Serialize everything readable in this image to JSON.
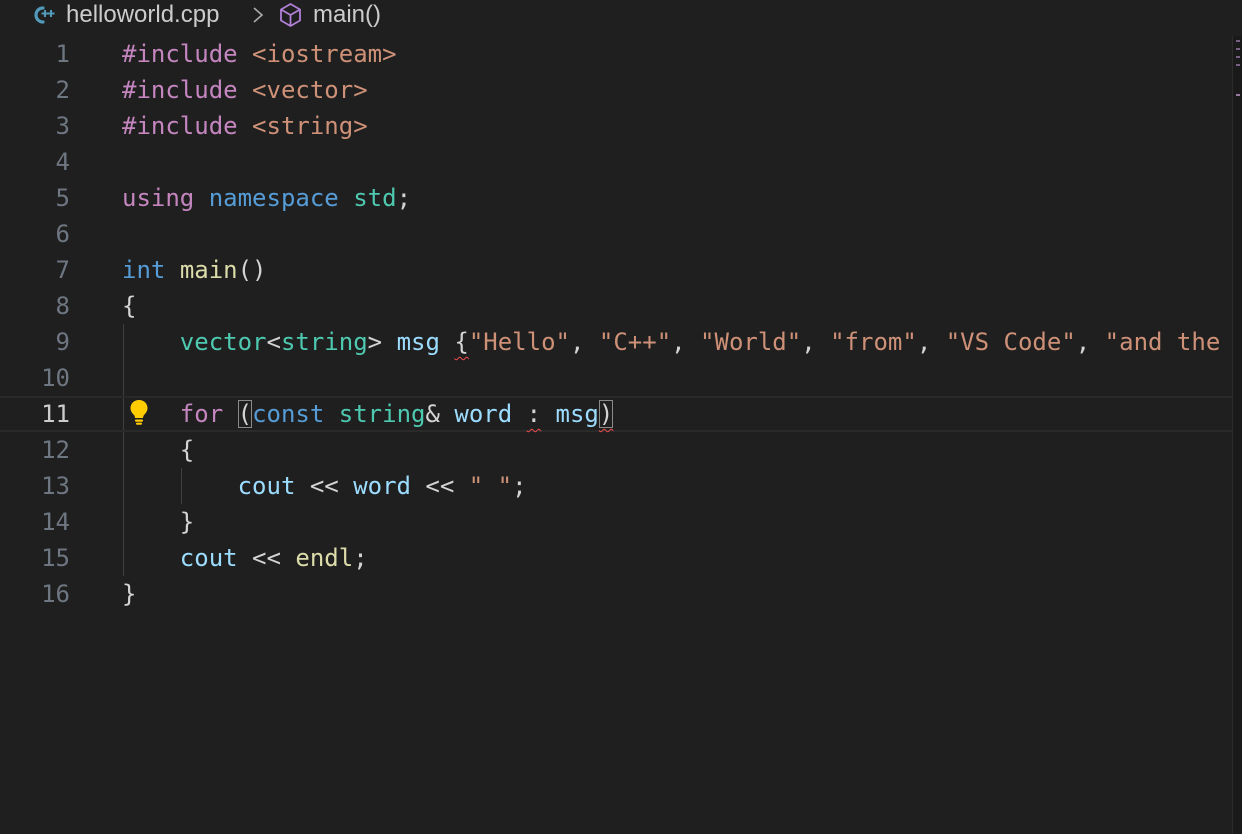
{
  "breadcrumb": {
    "file": "helloworld.cpp",
    "symbol": "main()",
    "file_icon": "cpp-file-icon",
    "separator_icon": "chevron-right-icon",
    "symbol_icon": "cube-method-icon"
  },
  "editor": {
    "current_line": 11,
    "line_numbers": [
      "1",
      "2",
      "3",
      "4",
      "5",
      "6",
      "7",
      "8",
      "9",
      "10",
      "11",
      "12",
      "13",
      "14",
      "15",
      "16"
    ],
    "code": {
      "l1": {
        "kw": "#include",
        "sp": " ",
        "hdr": "<iostream>"
      },
      "l2": {
        "kw": "#include",
        "sp": " ",
        "hdr": "<vector>"
      },
      "l3": {
        "kw": "#include",
        "sp": " ",
        "hdr": "<string>"
      },
      "l5": {
        "using": "using",
        "sp1": " ",
        "ns": "namespace",
        "sp2": " ",
        "std": "std",
        "semi": ";"
      },
      "l7": {
        "int": "int",
        "sp": " ",
        "main": "main",
        "parens": "()"
      },
      "l8": {
        "brace": "{"
      },
      "l9": {
        "indent": "    ",
        "vector": "vector",
        "lt": "<",
        "string": "string",
        "gt": ">",
        "sp1": " ",
        "msg": "msg",
        "sp2": " ",
        "brace": "{",
        "s1": "\"Hello\"",
        "c1": ", ",
        "s2": "\"C++\"",
        "c2": ", ",
        "s3": "\"World\"",
        "c3": ", ",
        "s4": "\"from\"",
        "c4": ", ",
        "s5": "\"VS Code\"",
        "c5": ", ",
        "s6": "\"and the"
      },
      "l11": {
        "indent": "    ",
        "for": "for",
        "sp1": " ",
        "lparen": "(",
        "const": "const",
        "sp2": " ",
        "string": "string",
        "amp": "&",
        "sp3": " ",
        "word": "word",
        "sp4": " ",
        "colon": ":",
        "sp5": " ",
        "msg": "msg",
        "rparen": ")"
      },
      "l12": {
        "indent": "    ",
        "brace": "{"
      },
      "l13": {
        "indent": "        ",
        "cout": "cout",
        "op1": " << ",
        "word": "word",
        "op2": " << ",
        "str": "\" \"",
        "semi": ";"
      },
      "l14": {
        "indent": "    ",
        "brace": "}"
      },
      "l15": {
        "indent": "    ",
        "cout": "cout",
        "op": " << ",
        "endl": "endl",
        "semi": ";"
      },
      "l16": {
        "brace": "}"
      }
    }
  },
  "icons": {
    "lightbulb": "lightbulb-icon"
  },
  "colors": {
    "background": "#1f1f1f",
    "preprocessor": "#c586c0",
    "string": "#ce9178",
    "keyword": "#569cd6",
    "type": "#4ec9b0",
    "function": "#dcdcaa",
    "variable": "#9cdcfe",
    "error_squiggle": "#f14c4c",
    "lightbulb": "#ffcc00"
  }
}
